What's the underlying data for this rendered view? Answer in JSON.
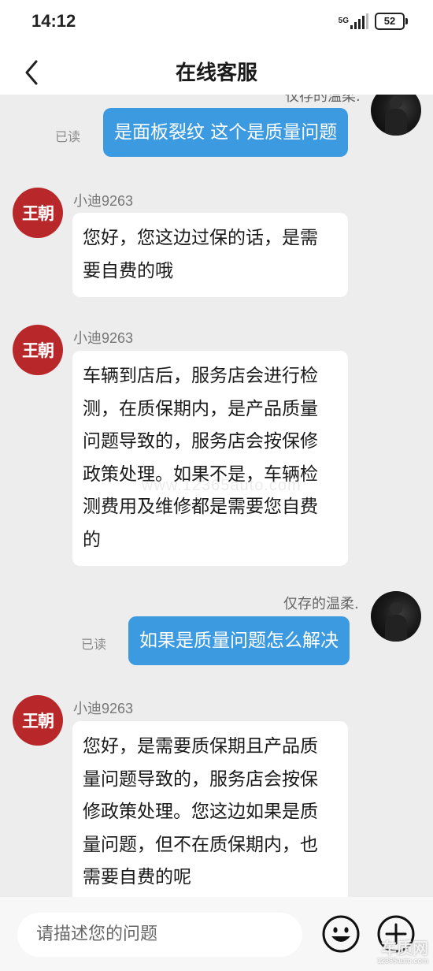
{
  "status_bar": {
    "time": "14:12",
    "network": "5G",
    "battery": "52"
  },
  "header": {
    "title": "在线客服",
    "back_icon": "chevron-left-icon"
  },
  "messages": [
    {
      "direction": "out",
      "sender": "仅存的温柔.",
      "read": "已读",
      "text": "是面板裂纹 这个是质量问题"
    },
    {
      "direction": "in",
      "sender": "小迪9263",
      "avatar_text": "王朝",
      "lines": [
        "您好，您这边过保的话，是需",
        "要自费的哦"
      ]
    },
    {
      "direction": "in",
      "sender": "小迪9263",
      "avatar_text": "王朝",
      "lines": [
        "车辆到店后，服务店会进行检",
        "测，在质保期内，是产品质量",
        "问题导致的，服务店会按保修",
        "政策处理。如果不是，车辆检",
        "测费用及维修都是需要您自费",
        "的"
      ]
    },
    {
      "direction": "out",
      "sender": "仅存的温柔.",
      "read": "已读",
      "text": "如果是质量问题怎么解决"
    },
    {
      "direction": "in",
      "sender": "小迪9263",
      "avatar_text": "王朝",
      "lines": [
        "您好，是需要质保期且产品质",
        "量问题导致的，服务店会按保",
        "修政策处理。您这边如果是质",
        "量问题，但不在质保期内，也",
        "需要自费的呢"
      ]
    }
  ],
  "input": {
    "placeholder": "请描述您的问题",
    "emoji_icon": "emoji-icon",
    "add_icon": "plus-circle-icon"
  },
  "watermark": {
    "name": "车质网",
    "url": "12365auto.com",
    "center": "www.12365auto.com"
  },
  "colors": {
    "bubble_out": "#3b9ae0",
    "agent_avatar": "#b8282a",
    "background": "#ededed"
  }
}
